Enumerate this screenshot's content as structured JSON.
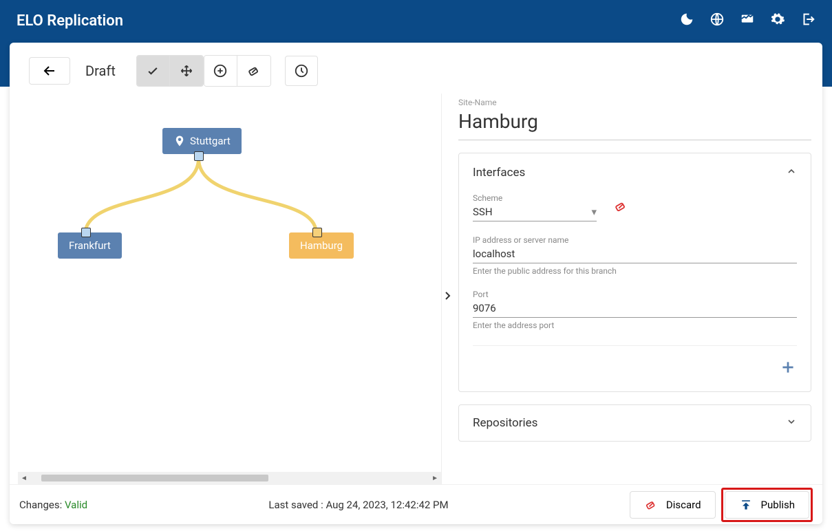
{
  "app_title": "ELO Replication",
  "header_icons": [
    "moon-icon",
    "globe-icon",
    "monitor-icon",
    "gear-icon",
    "logout-icon"
  ],
  "toolbar": {
    "mode_label": "Draft",
    "tools": [
      "check",
      "move",
      "add",
      "erase"
    ],
    "extra": "history"
  },
  "canvas": {
    "nodes": [
      {
        "id": "stuttgart",
        "label": "Stuttgart",
        "type": "root"
      },
      {
        "id": "frankfurt",
        "label": "Frankfurt",
        "type": "branch"
      },
      {
        "id": "hamburg",
        "label": "Hamburg",
        "type": "branch-selected"
      }
    ]
  },
  "details": {
    "site_label": "Site-Name",
    "site_name": "Hamburg",
    "sections": {
      "interfaces": {
        "title": "Interfaces",
        "expanded": true,
        "scheme_label": "Scheme",
        "scheme_value": "SSH",
        "ip_label": "IP address or server name",
        "ip_value": "localhost",
        "ip_hint": "Enter the public address for this branch",
        "port_label": "Port",
        "port_value": "9076",
        "port_hint": "Enter the address port"
      },
      "repositories": {
        "title": "Repositories",
        "expanded": false
      }
    }
  },
  "footer": {
    "changes_label": "Changes: ",
    "changes_status": "Valid",
    "saved_label": "Last saved : ",
    "saved_time": "Aug 24, 2023, 12:42:42 PM",
    "discard_label": "Discard",
    "publish_label": "Publish"
  }
}
